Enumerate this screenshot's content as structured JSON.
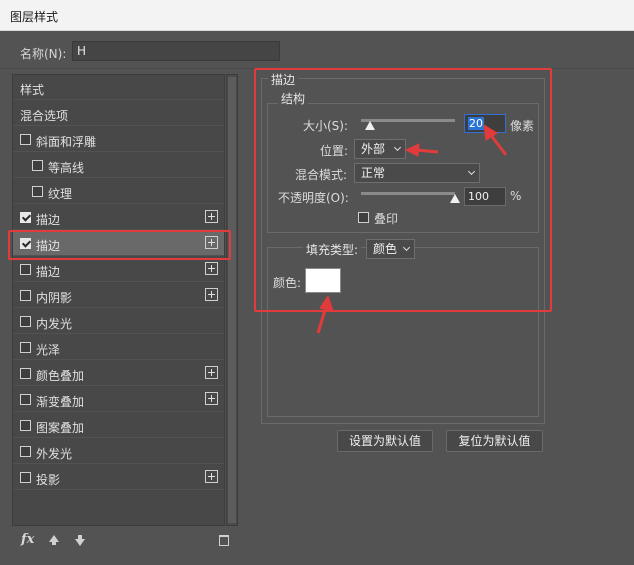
{
  "window": {
    "title": "图层样式"
  },
  "name_field": {
    "label": "名称(N):",
    "value": "H"
  },
  "styles_list": {
    "items": [
      {
        "label": "样式",
        "checkbox": false,
        "checked": false,
        "plus": false,
        "indent": 0
      },
      {
        "label": "混合选项",
        "checkbox": false,
        "checked": false,
        "plus": false,
        "indent": 0
      },
      {
        "label": "斜面和浮雕",
        "checkbox": true,
        "checked": false,
        "plus": false,
        "indent": 0
      },
      {
        "label": "等高线",
        "checkbox": true,
        "checked": false,
        "plus": false,
        "indent": 1
      },
      {
        "label": "纹理",
        "checkbox": true,
        "checked": false,
        "plus": false,
        "indent": 1
      },
      {
        "label": "描边",
        "checkbox": true,
        "checked": true,
        "plus": true,
        "indent": 0
      },
      {
        "label": "描边",
        "checkbox": true,
        "checked": true,
        "plus": true,
        "indent": 0,
        "selected": true
      },
      {
        "label": "描边",
        "checkbox": true,
        "checked": false,
        "plus": true,
        "indent": 0
      },
      {
        "label": "内阴影",
        "checkbox": true,
        "checked": false,
        "plus": true,
        "indent": 0
      },
      {
        "label": "内发光",
        "checkbox": true,
        "checked": false,
        "plus": false,
        "indent": 0
      },
      {
        "label": "光泽",
        "checkbox": true,
        "checked": false,
        "plus": false,
        "indent": 0
      },
      {
        "label": "颜色叠加",
        "checkbox": true,
        "checked": false,
        "plus": true,
        "indent": 0
      },
      {
        "label": "渐变叠加",
        "checkbox": true,
        "checked": false,
        "plus": true,
        "indent": 0
      },
      {
        "label": "图案叠加",
        "checkbox": true,
        "checked": false,
        "plus": false,
        "indent": 0
      },
      {
        "label": "外发光",
        "checkbox": true,
        "checked": false,
        "plus": false,
        "indent": 0
      },
      {
        "label": "投影",
        "checkbox": true,
        "checked": false,
        "plus": true,
        "indent": 0
      }
    ]
  },
  "bottom_toolbar": {
    "fx_label": "fx"
  },
  "stroke_panel": {
    "title": "描边",
    "structure": {
      "title": "结构",
      "size_label": "大小(S):",
      "size_value": "20",
      "size_unit": "像素",
      "size_slider_level": 0.1,
      "position_label": "位置:",
      "position_value": "外部",
      "blend_label": "混合模式:",
      "blend_value": "正常",
      "opacity_label": "不透明度(O):",
      "opacity_value": "100",
      "opacity_unit": "%",
      "opacity_slider_level": 1.0,
      "overprint_label": "叠印"
    },
    "fill": {
      "type_label": "填充类型:",
      "type_value": "颜色",
      "color_label": "颜色:",
      "color_value": "#ffffff"
    }
  },
  "buttons": {
    "set_default": "设置为默认值",
    "reset_default": "复位为默认值"
  },
  "annotation": {
    "highlight_color": "#e23b3b"
  }
}
